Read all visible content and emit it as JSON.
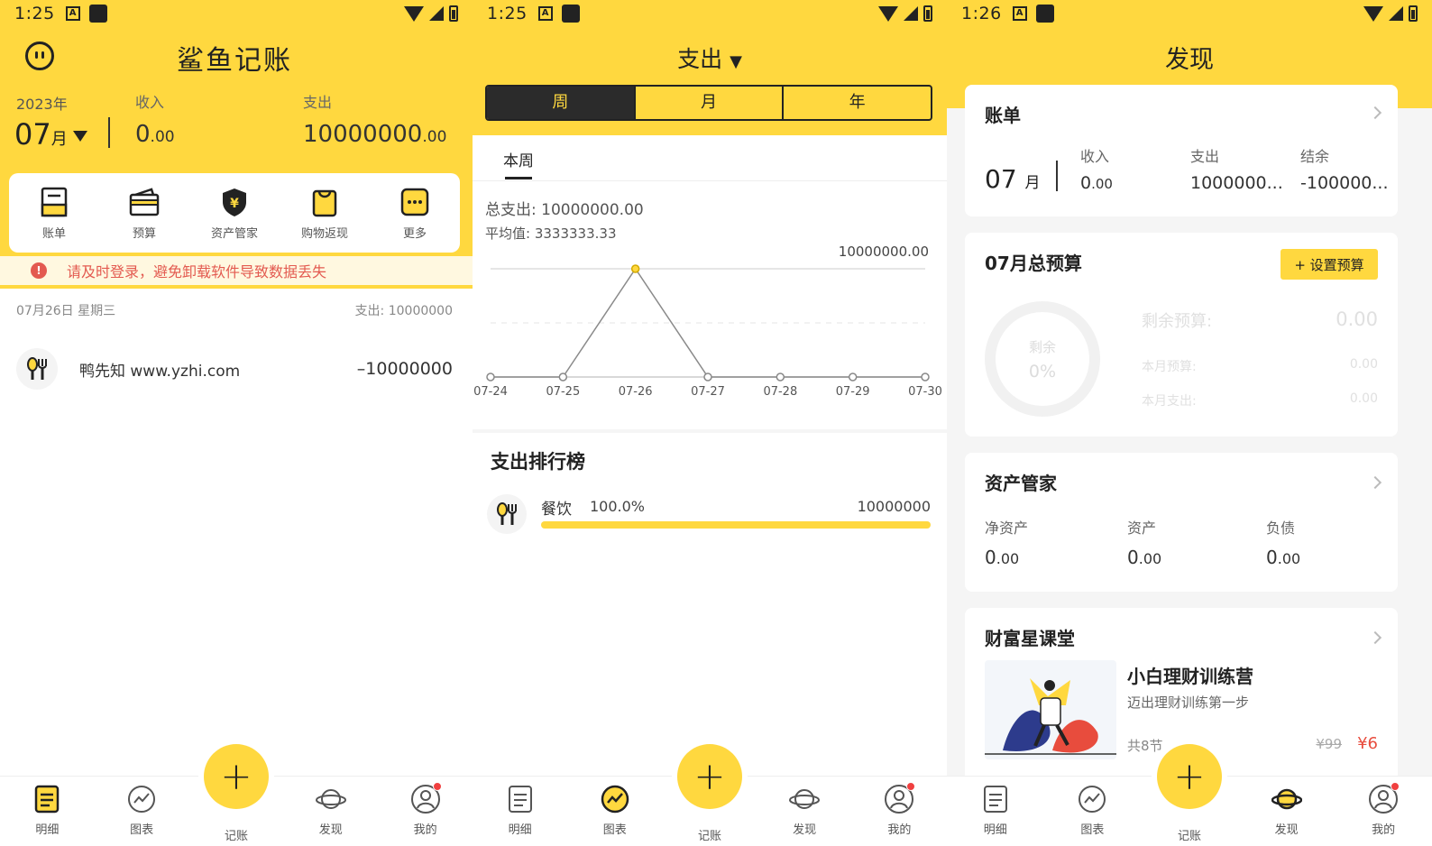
{
  "colors": {
    "accent": "#ffd83f",
    "dark": "#222222",
    "danger": "#e35a50"
  },
  "status": [
    {
      "time": "1:25",
      "a_badge": "A"
    },
    {
      "time": "1:25",
      "a_badge": "A"
    },
    {
      "time": "1:26",
      "a_badge": "A"
    }
  ],
  "tabbar": {
    "items": [
      {
        "label": "明细",
        "icon": "list-icon"
      },
      {
        "label": "图表",
        "icon": "chart-icon"
      },
      {
        "label": "记账",
        "icon": "plus-icon"
      },
      {
        "label": "发现",
        "icon": "planet-icon"
      },
      {
        "label": "我的",
        "icon": "user-icon"
      }
    ],
    "plus": "+"
  },
  "panel1": {
    "title": "鲨鱼记账",
    "year": "2023年",
    "month": "07",
    "month_unit": "月",
    "income_label": "收入",
    "income_int": "0",
    "income_dec": ".00",
    "expense_label": "支出",
    "expense_int": "10000000",
    "expense_dec": ".00",
    "shortcuts": [
      {
        "label": "账单",
        "icon": "bill-icon"
      },
      {
        "label": "预算",
        "icon": "wallet-icon"
      },
      {
        "label": "资产管家",
        "icon": "shield-yen-icon"
      },
      {
        "label": "购物返现",
        "icon": "shopping-bag-icon"
      },
      {
        "label": "更多",
        "icon": "more-icon"
      }
    ],
    "warning_icon": "!",
    "warning": "请及时登录，避免卸载软件导致数据丢失",
    "day_label": "07月26日 星期三",
    "day_expense_label": "支出:",
    "day_expense": "10000000",
    "record": {
      "name": "鸭先知 www.yzhi.com",
      "amount": "–10000000",
      "icon": "food-icon"
    }
  },
  "panel2": {
    "title": "支出",
    "segments": [
      "周",
      "月",
      "年"
    ],
    "subtab": "本周",
    "total_label": "总支出:",
    "total": "10000000.00",
    "avg_label": "平均值:",
    "avg": "3333333.33",
    "max_label": "10000000.00",
    "rank_title": "支出排行榜",
    "rank": {
      "name": "餐饮",
      "pct": "100.0%",
      "amount": "10000000",
      "fraction": 1.0,
      "icon": "food-icon"
    },
    "chart_data": {
      "type": "line",
      "x": [
        "07-24",
        "07-25",
        "07-26",
        "07-27",
        "07-28",
        "07-29",
        "07-30"
      ],
      "values": [
        0,
        0,
        10000000,
        0,
        0,
        0,
        0
      ],
      "ylim": [
        0,
        10000000
      ],
      "grid": true,
      "highlight_index": 2
    }
  },
  "panel3": {
    "title": "发现",
    "bill": {
      "title": "账单",
      "month": "07",
      "month_unit": "月",
      "income_label": "收入",
      "income_int": "0",
      "income_dec": ".00",
      "expense_label": "支出",
      "expense": "1000000...",
      "balance_label": "结余",
      "balance": "-100000..."
    },
    "budget": {
      "title": "07月总预算",
      "button": "+ 设置预算",
      "ring_label": "剩余",
      "ring_value": "0%",
      "remain_label": "剩余预算:",
      "remain": "0.00",
      "month_budget_label": "本月预算:",
      "month_budget": "0.00",
      "month_expense_label": "本月支出:",
      "month_expense": "0.00"
    },
    "assets": {
      "title": "资产管家",
      "net_label": "净资产",
      "net_int": "0",
      "net_dec": ".00",
      "asset_label": "资产",
      "asset_int": "0",
      "asset_dec": ".00",
      "debt_label": "负债",
      "debt_int": "0",
      "debt_dec": ".00"
    },
    "course": {
      "section": "财富星课堂",
      "title": "小白理财训练营",
      "subtitle": "迈出理财训练第一步",
      "count": "共8节",
      "old_price": "¥99",
      "price": "¥6"
    }
  }
}
